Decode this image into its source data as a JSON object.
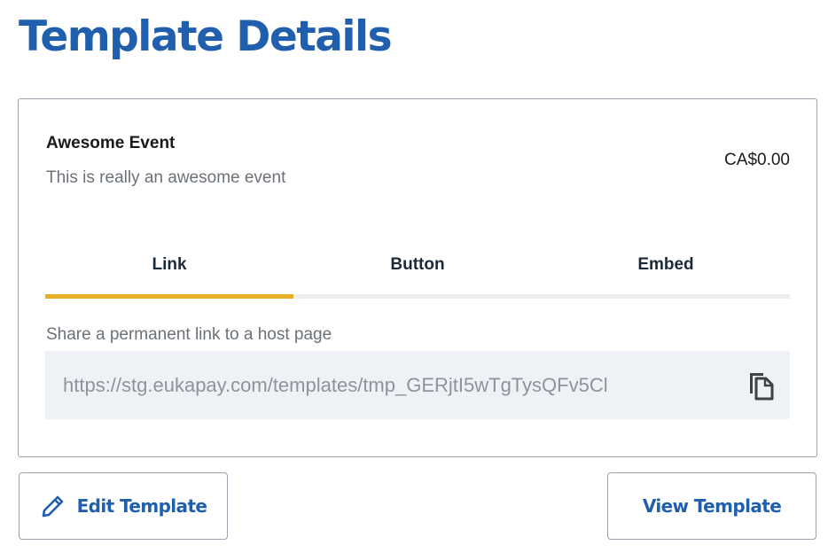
{
  "page": {
    "title": "Template Details"
  },
  "event": {
    "name": "Awesome Event",
    "description": "This is really an awesome event",
    "price": "CA$0.00"
  },
  "tabs": [
    {
      "label": "Link",
      "active": true
    },
    {
      "label": "Button",
      "active": false
    },
    {
      "label": "Embed",
      "active": false
    }
  ],
  "share": {
    "label": "Share a permanent link to a host page",
    "url": "https://stg.eukapay.com/templates/tmp_GERjtI5wTgTysQFv5Cl",
    "copy_icon": "copy-icon"
  },
  "actions": {
    "edit_label": "Edit Template",
    "edit_icon": "pencil-icon",
    "view_label": "View Template"
  },
  "colors": {
    "primary": "#1f5fae",
    "tab_active_indicator": "#e9ac24",
    "link_background": "#eef1f5"
  }
}
